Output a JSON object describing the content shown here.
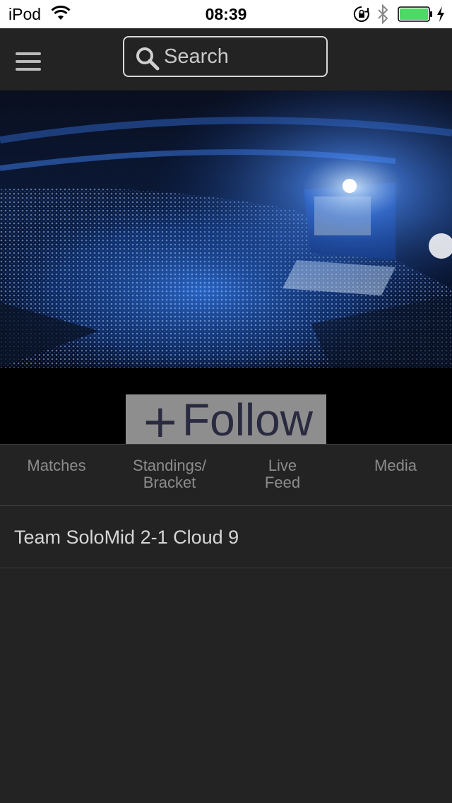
{
  "status_bar": {
    "carrier": "iPod",
    "time": "08:39",
    "battery_color": "#4cd964"
  },
  "header": {
    "search_placeholder": "Search"
  },
  "follow": {
    "plus": "+",
    "label": "Follow"
  },
  "tabs": [
    {
      "label": "Matches"
    },
    {
      "label": "Standings/\nBracket"
    },
    {
      "label": "Live\nFeed"
    },
    {
      "label": "Media"
    }
  ],
  "matches": [
    {
      "label": "Team SoloMid 2-1 Cloud 9"
    }
  ]
}
